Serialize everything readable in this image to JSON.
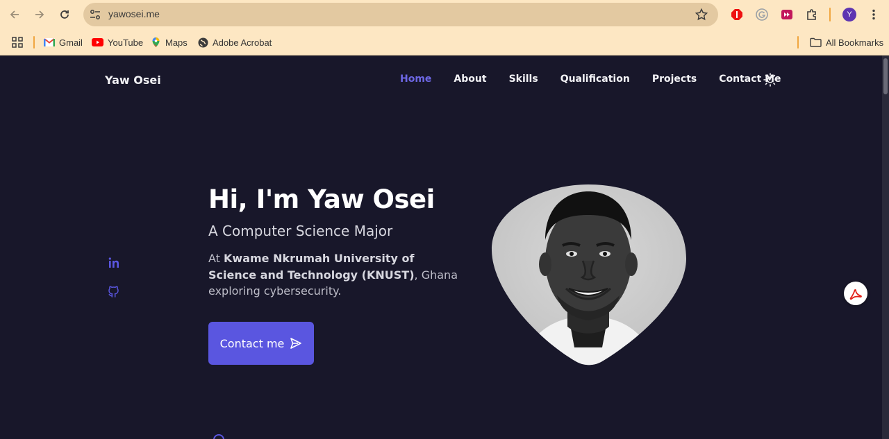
{
  "browser": {
    "url": "yawosei.me",
    "profile_initial": "Y",
    "bookmarks": [
      {
        "label": "Gmail"
      },
      {
        "label": "YouTube"
      },
      {
        "label": "Maps"
      },
      {
        "label": "Adobe Acrobat"
      }
    ],
    "all_bookmarks_label": "All Bookmarks"
  },
  "site": {
    "logo": "Yaw Osei",
    "nav": [
      {
        "label": "Home",
        "active": true
      },
      {
        "label": "About"
      },
      {
        "label": "Skills"
      },
      {
        "label": "Qualification"
      },
      {
        "label": "Projects"
      },
      {
        "label": "Contact Me"
      }
    ]
  },
  "hero": {
    "title": "Hi, I'm Yaw Osei",
    "subtitle": "A Computer Science Major",
    "desc_prefix": "At ",
    "desc_bold": "Kwame Nkrumah University of Science and Technology (KNUST)",
    "desc_suffix": ", Ghana exploring cybersecurity.",
    "cta_label": "Contact me"
  },
  "colors": {
    "page_bg": "#18172a",
    "accent": "#5a56e0",
    "nav_active": "#6d67e4",
    "chrome_bg": "#fde7c3"
  },
  "icons": {
    "social": [
      "linkedin-icon",
      "github-icon"
    ],
    "theme": "sun-icon",
    "cta": "send-icon"
  }
}
